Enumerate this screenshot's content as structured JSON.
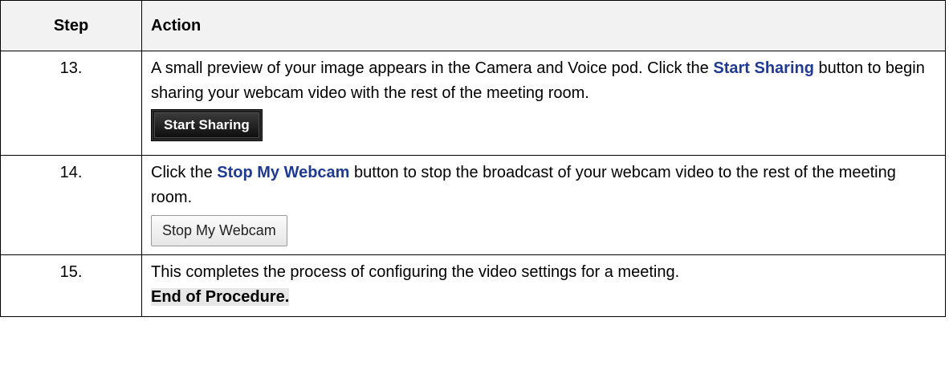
{
  "table": {
    "headers": {
      "step": "Step",
      "action": "Action"
    },
    "rows": [
      {
        "step": "13.",
        "text_1": "A small preview of your image appears in the Camera and Voice pod. Click the ",
        "keyword": "Start Sharing",
        "text_2": " button to begin sharing your webcam video with the rest of the meeting room.",
        "button_label": "Start Sharing"
      },
      {
        "step": "14.",
        "text_1": "Click the ",
        "keyword": "Stop My Webcam",
        "text_2": " button to stop the broadcast of your webcam video to the rest of the meeting room.",
        "button_label": "Stop My Webcam"
      },
      {
        "step": "15.",
        "text_1": "This completes the process of configuring the video settings for a meeting.",
        "end_text": "End of Procedure."
      }
    ]
  },
  "colors": {
    "keyword": "#1f3a93",
    "header_bg": "#f2f2f2",
    "end_highlight": "#e7e7e7"
  }
}
